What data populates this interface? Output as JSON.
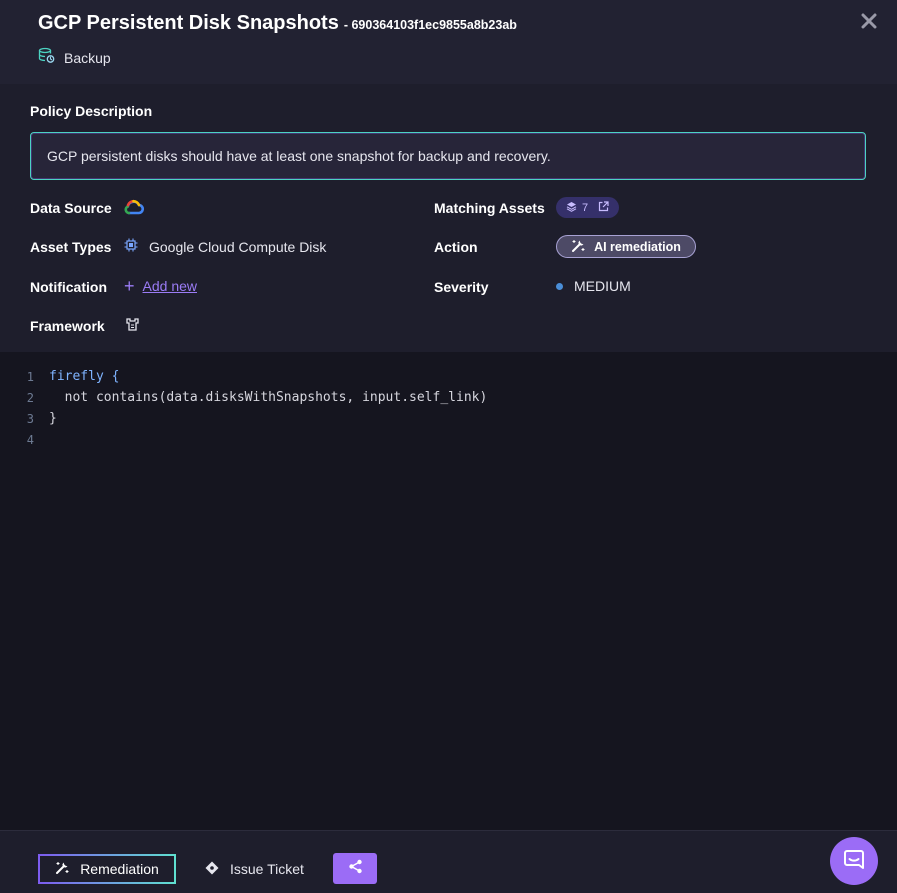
{
  "header": {
    "title": "GCP Persistent Disk Snapshots",
    "policy_id": "- 690364103f1ec9855a8b23ab",
    "category": "Backup",
    "icons": {
      "category": "database-refresh-icon",
      "close": "close-icon"
    }
  },
  "policy": {
    "description_label": "Policy Description",
    "description": "GCP persistent disks should have at least one snapshot for backup and recovery."
  },
  "fields": {
    "data_source": {
      "label": "Data Source",
      "icon": "google-cloud-icon"
    },
    "asset_types": {
      "label": "Asset Types",
      "value": "Google Cloud Compute Disk",
      "icon": "chip-icon"
    },
    "notification": {
      "label": "Notification",
      "add_label": "Add new"
    },
    "framework": {
      "label": "Framework",
      "icon": "framework-icon"
    },
    "matching_assets": {
      "label": "Matching Assets",
      "count": "7"
    },
    "action": {
      "label": "Action",
      "button_label": "AI remediation"
    },
    "severity": {
      "label": "Severity",
      "value": "MEDIUM",
      "color": "#4a8ed8"
    }
  },
  "code": {
    "lines": [
      {
        "num": "1",
        "text": "firefly {"
      },
      {
        "num": "2",
        "text": "  not contains(data.disksWithSnapshots, input.self_link)"
      },
      {
        "num": "3",
        "text": "}"
      },
      {
        "num": "4",
        "text": ""
      }
    ]
  },
  "footer": {
    "remediation_label": "Remediation",
    "ticket_label": "Issue Ticket"
  },
  "colors": {
    "accent": "#9b6cf6",
    "teal": "#4cd3c2",
    "keyword": "#7fb4ff"
  }
}
